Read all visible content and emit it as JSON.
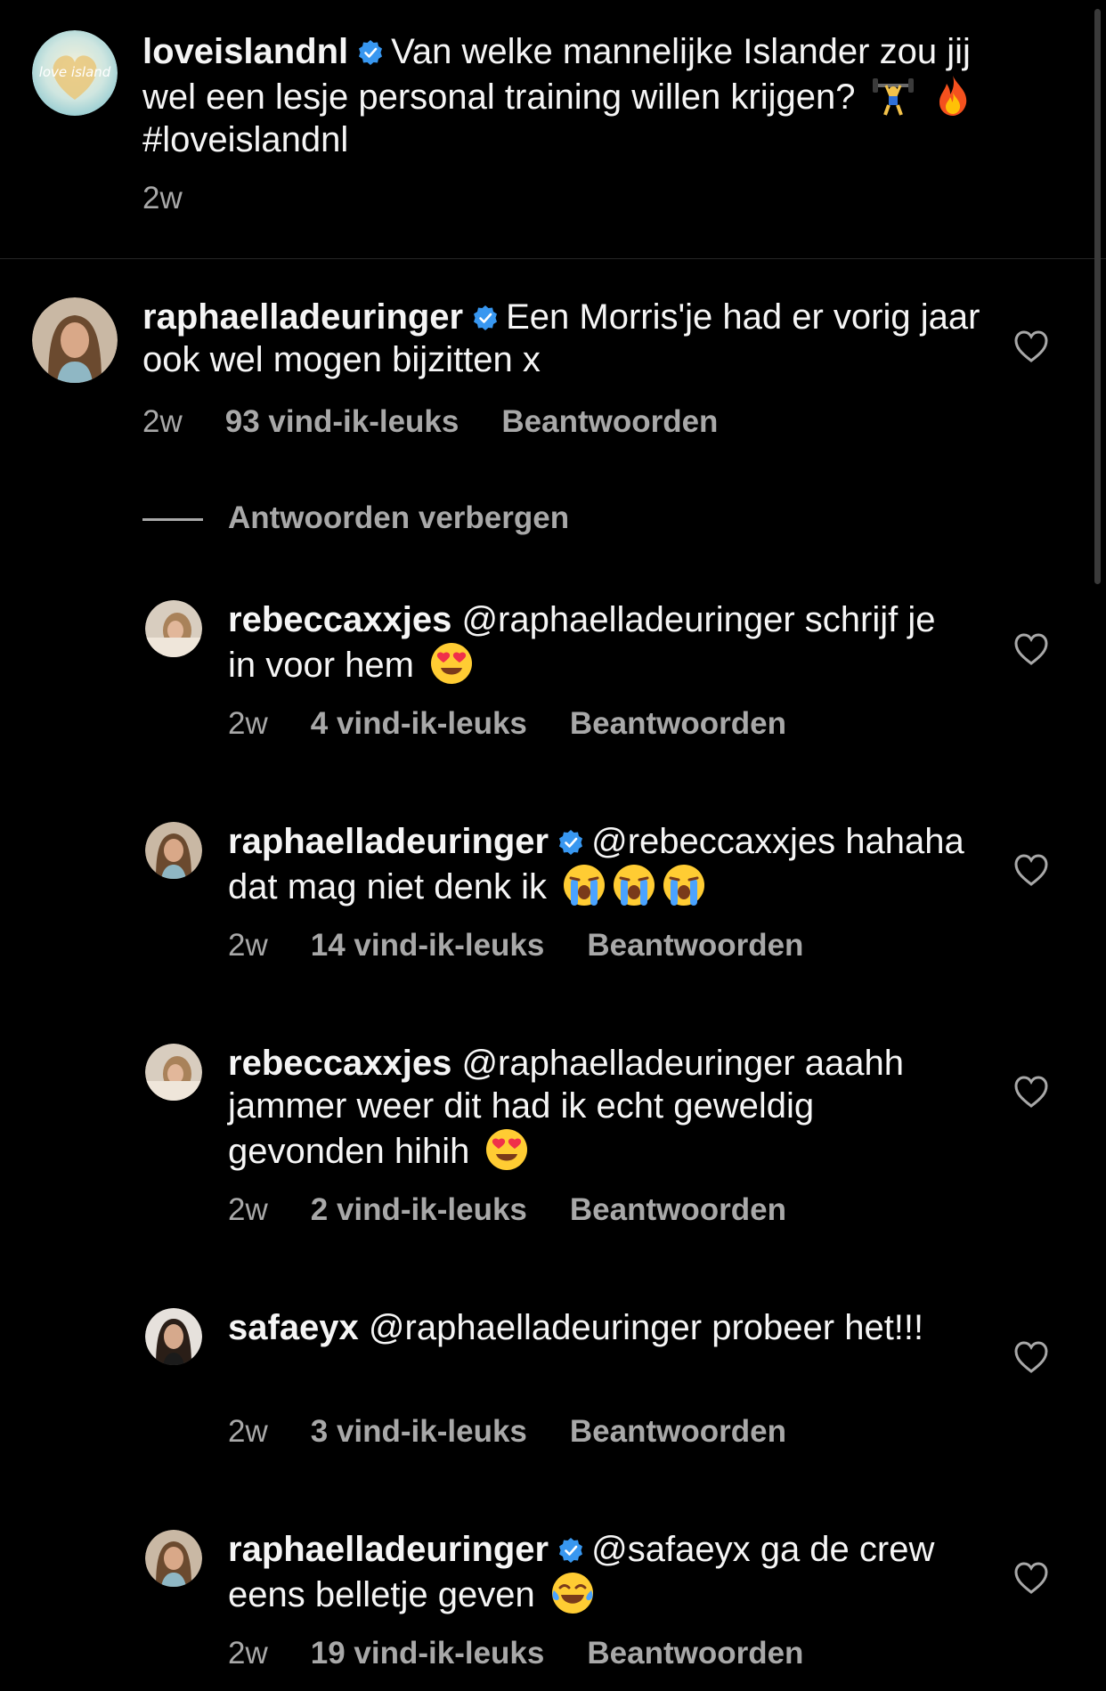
{
  "caption": {
    "username": "loveislandnl",
    "text": "Van welke mannelijke Islander zou jij wel een lesje personal training willen krijgen?",
    "emojis": [
      "weightlifter-emoji",
      "fire-emoji"
    ],
    "hashtag": "#loveislandnl",
    "time": "2w",
    "avatar_logo_text": "love island"
  },
  "comment": {
    "username": "raphaelladeuringer",
    "text": "Een Morris'je had er vorig jaar ook wel mogen bijzitten x",
    "time": "2w",
    "likes": "93 vind-ik-leuks",
    "reply_label": "Beantwoorden"
  },
  "hide_replies_label": "Antwoorden verbergen",
  "replies": [
    {
      "username": "rebeccaxxjes",
      "text": "@raphaelladeuringer schrijf je in voor hem",
      "emojis": [
        "heart-eyes-emoji"
      ],
      "time": "2w",
      "likes": "4 vind-ik-leuks",
      "reply_label": "Beantwoorden"
    },
    {
      "username": "raphaelladeuringer",
      "text": "@rebeccaxxjes hahaha dat mag niet denk ik",
      "emojis": [
        "loudly-crying-emoji",
        "loudly-crying-emoji",
        "loudly-crying-emoji"
      ],
      "time": "2w",
      "likes": "14 vind-ik-leuks",
      "reply_label": "Beantwoorden"
    },
    {
      "username": "rebeccaxxjes",
      "text": "@raphaelladeuringer aaahh jammer weer dit had ik echt geweldig gevonden hihih",
      "emojis": [
        "heart-eyes-emoji"
      ],
      "time": "2w",
      "likes": "2 vind-ik-leuks",
      "reply_label": "Beantwoorden"
    },
    {
      "username": "safaeyx",
      "text": "@raphaelladeuringer probeer het!!!",
      "emojis": [],
      "time": "2w",
      "likes": "3 vind-ik-leuks",
      "reply_label": "Beantwoorden"
    },
    {
      "username": "raphaelladeuringer",
      "text": "@safaeyx ga de crew eens belletje geven",
      "emojis": [
        "tears-of-joy-emoji"
      ],
      "time": "2w",
      "likes": "19 vind-ik-leuks",
      "reply_label": "Beantwoorden"
    }
  ],
  "colors": {
    "background": "#000000",
    "text": "#f5f5f5",
    "secondary": "#a8a8a8",
    "verified": "#3897f0"
  }
}
